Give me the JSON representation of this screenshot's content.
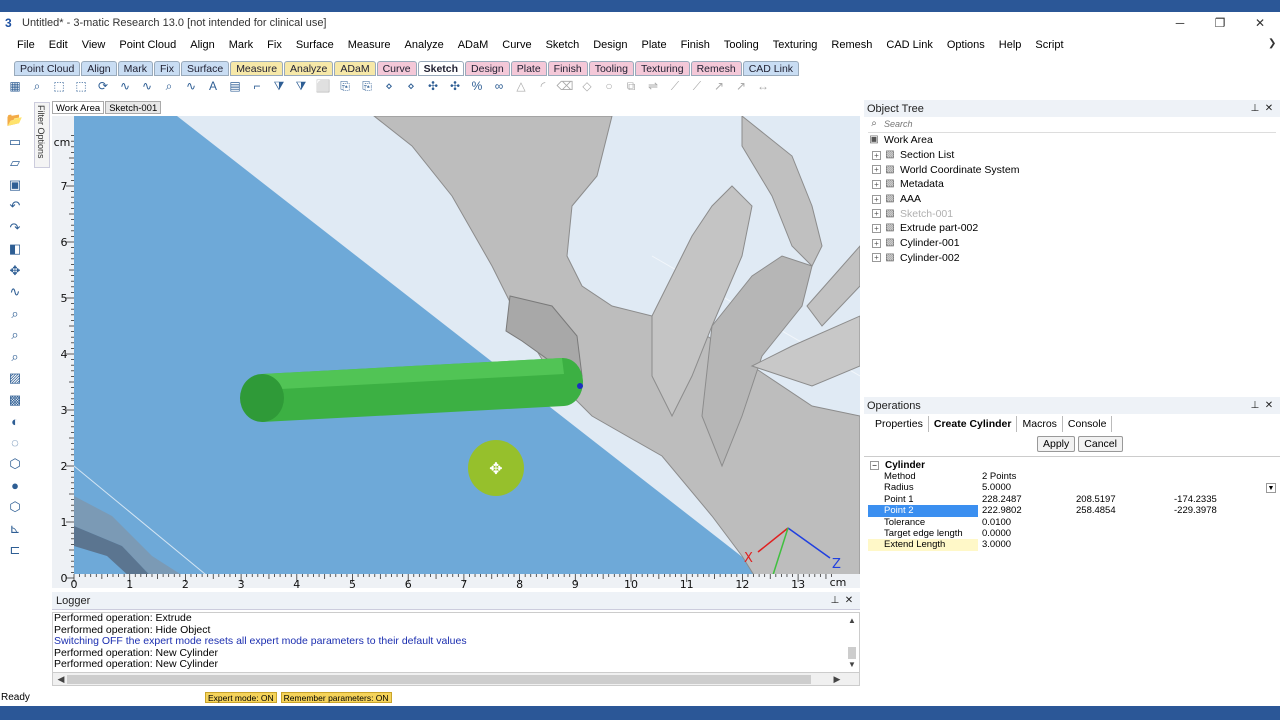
{
  "window": {
    "title": "Untitled* - 3-matic Research 13.0  [not intended for clinical use]",
    "app_icon": "3",
    "controls": {
      "minimize": "─",
      "restore": "❐",
      "close": "✕"
    }
  },
  "menu": [
    "File",
    "Edit",
    "View",
    "Point Cloud",
    "Align",
    "Mark",
    "Fix",
    "Surface",
    "Measure",
    "Analyze",
    "ADaM",
    "Curve",
    "Sketch",
    "Design",
    "Plate",
    "Finish",
    "Tooling",
    "Texturing",
    "Remesh",
    "CAD Link",
    "Options",
    "Help",
    "Script"
  ],
  "ribbon_tabs": [
    {
      "label": "Point Cloud",
      "color": "#c9ddf3"
    },
    {
      "label": "Align",
      "color": "#c9ddf3"
    },
    {
      "label": "Mark",
      "color": "#c9ddf3"
    },
    {
      "label": "Fix",
      "color": "#c9ddf3"
    },
    {
      "label": "Surface",
      "color": "#c9ddf3"
    },
    {
      "label": "Measure",
      "color": "#f6e8a8"
    },
    {
      "label": "Analyze",
      "color": "#f6e8a8"
    },
    {
      "label": "ADaM",
      "color": "#f6e8a8"
    },
    {
      "label": "Curve",
      "color": "#f4c8d8"
    },
    {
      "label": "Sketch",
      "color": "#f4c8d8",
      "active": true
    },
    {
      "label": "Design",
      "color": "#f4c8d8"
    },
    {
      "label": "Plate",
      "color": "#f4c8d8"
    },
    {
      "label": "Finish",
      "color": "#f4c8d8"
    },
    {
      "label": "Tooling",
      "color": "#f4c8d8"
    },
    {
      "label": "Texturing",
      "color": "#f4c8d8"
    },
    {
      "label": "Remesh",
      "color": "#f4c8d8"
    },
    {
      "label": "CAD Link",
      "color": "#c9ddf3"
    }
  ],
  "toolbar_icons": [
    "grid-icon",
    "zoom-fit-icon",
    "select-icon",
    "select-box-icon",
    "rotate-icon",
    "curve-point-icon",
    "curve-line-icon",
    "zoom-icon",
    "spline-icon",
    "text-icon",
    "table-icon",
    "corner-icon",
    "filter-icon",
    "filter-icon-2",
    "frame-icon",
    "attach-icon",
    "attach-icon-2",
    "node-icon",
    "node-icon-2",
    "snap-icon",
    "snap-icon-2",
    "percent-icon",
    "loops-icon",
    "triangle-icon",
    "arc-icon",
    "eraser-icon",
    "diamond-icon",
    "circle-icon",
    "copy-icon",
    "mirror-icon",
    "measure-icon",
    "measure-icon-2",
    "arrow-icon",
    "arrow-icon-2",
    "double-arrow-icon"
  ],
  "left_toolbar_icons": [
    "open-folder-icon",
    "new-file-icon",
    "folder-icon",
    "save-icon",
    "undo-icon",
    "redo-icon",
    "box-icon",
    "move-icon",
    "curve-tool-icon",
    "zoom-tool-icon",
    "search-tool-icon",
    "zoom-region-icon",
    "image-icon",
    "wireframe-icon",
    "shade-icon",
    "transparent-icon",
    "cube-icon",
    "sphere-icon",
    "cube-color-icon",
    "axis-icon",
    "ruler-icon"
  ],
  "filter_options": "Filter Options",
  "view_tabs": [
    "Work Area",
    "Sketch-001"
  ],
  "viewport": {
    "unit": "cm",
    "background": "#dbe6f2",
    "sketch_plane_color": "#6ea9d8",
    "cylinder_color": "#3cb043",
    "mesh_color": "#b8b8b8",
    "cursor_color": "#9ac21a",
    "x_ticks": [
      "0",
      "1",
      "2",
      "3",
      "4",
      "5",
      "6",
      "7",
      "8",
      "9",
      "10",
      "11",
      "12",
      "13"
    ],
    "y_ticks": [
      "0",
      "1",
      "2",
      "3",
      "4",
      "5",
      "6",
      "7"
    ],
    "axis_labels": {
      "x": "X",
      "z": "Z"
    }
  },
  "object_tree": {
    "title": "Object Tree",
    "search_placeholder": "Search",
    "root": "Work Area",
    "items": [
      {
        "label": "Section List",
        "muted": false,
        "icon": "section-icon"
      },
      {
        "label": "World Coordinate System",
        "muted": false,
        "icon": "coordinate-icon"
      },
      {
        "label": "Metadata",
        "muted": false,
        "icon": "metadata-icon"
      },
      {
        "label": "AAA",
        "muted": false,
        "icon": "part-icon"
      },
      {
        "label": "Sketch-001",
        "muted": true,
        "icon": "sketch-icon"
      },
      {
        "label": "Extrude part-002",
        "muted": false,
        "icon": "part-icon"
      },
      {
        "label": "Cylinder-001",
        "muted": false,
        "icon": "part-icon"
      },
      {
        "label": "Cylinder-002",
        "muted": false,
        "icon": "part-icon"
      }
    ]
  },
  "operations": {
    "title": "Operations",
    "tabs": [
      "Properties",
      "Create Cylinder",
      "Macros",
      "Console"
    ],
    "active_tab": "Create Cylinder",
    "apply_label": "Apply",
    "cancel_label": "Cancel",
    "group": "Cylinder",
    "rows": [
      {
        "name": "Method",
        "v1": "2 Points",
        "v2": "",
        "v3": ""
      },
      {
        "name": "Radius",
        "v1": "5.0000",
        "v2": "",
        "v3": ""
      },
      {
        "name": "Point 1",
        "v1": "228.2487",
        "v2": "208.5197",
        "v3": "-174.2335"
      },
      {
        "name": "Point 2",
        "v1": "222.9802",
        "v2": "258.4854",
        "v3": "-229.3978",
        "selected": true
      },
      {
        "name": "Tolerance",
        "v1": "0.0100",
        "v2": "",
        "v3": ""
      },
      {
        "name": "Target edge length",
        "v1": "0.0000",
        "v2": "",
        "v3": ""
      },
      {
        "name": "Extend Length",
        "v1": "3.0000",
        "v2": "",
        "v3": "",
        "highlight": true
      }
    ]
  },
  "logger": {
    "title": "Logger",
    "lines": [
      {
        "text": "Performed operation: Extrude",
        "blue": false
      },
      {
        "text": "Performed operation: Hide Object",
        "blue": false
      },
      {
        "text": "Switching OFF the expert mode resets all expert mode parameters to their default values",
        "blue": true
      },
      {
        "text": "Performed operation: New Cylinder",
        "blue": false
      },
      {
        "text": "Performed operation: New Cylinder",
        "blue": false
      }
    ]
  },
  "status": {
    "ready": "Ready",
    "badges": [
      "Expert mode: ON",
      "Remember parameters: ON"
    ]
  }
}
